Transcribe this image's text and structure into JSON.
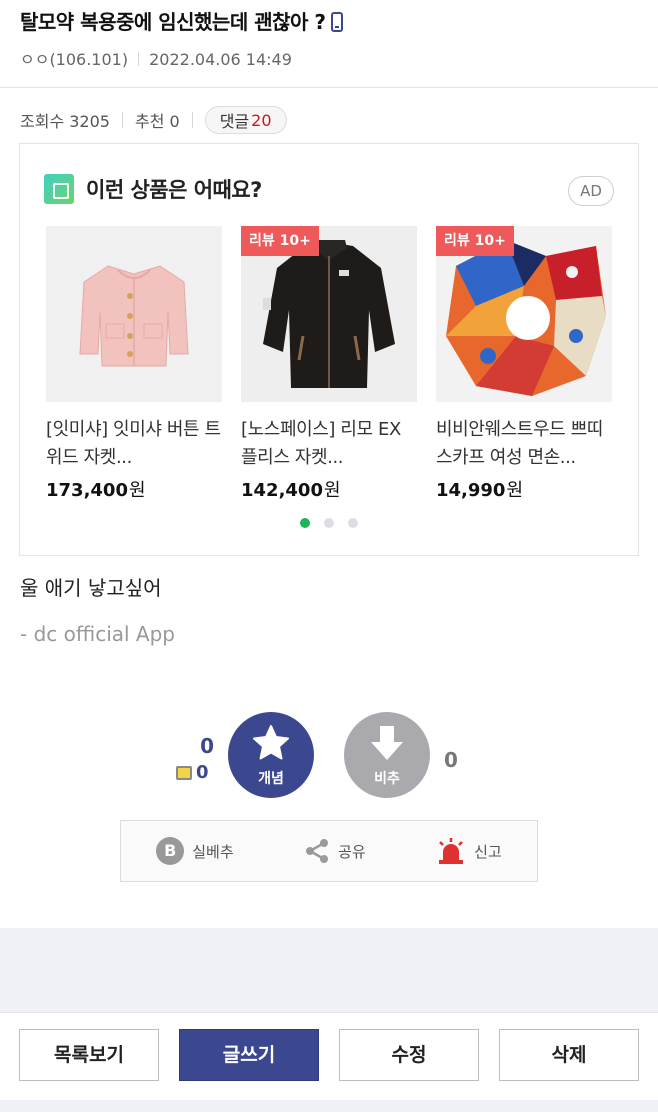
{
  "post": {
    "title": "탈모약 복용중에 임신했는데 괜찮아 ?",
    "author": "ㅇㅇ(106.101)",
    "datetime": "2022.04.06 14:49",
    "views_label": "조회수 3205",
    "recommend_label": "추천 0",
    "comments_label": "댓글",
    "comments_count": "20",
    "body": "울 애기 낳고싶어",
    "source": "- dc official App"
  },
  "ad": {
    "title": "이런 상품은 어때요?",
    "badge": "AD",
    "products": [
      {
        "name": "[잇미샤] 잇미샤 버튼 트위드 자켓...",
        "price": "173,400",
        "currency": "원",
        "tag": ""
      },
      {
        "name": "[노스페이스] 리모 EX 플리스 자켓...",
        "price": "142,400",
        "currency": "원",
        "tag": "리뷰 10+"
      },
      {
        "name": "비비안웨스트우드 쁘띠스카프 여성 면손...",
        "price": "14,990",
        "currency": "원",
        "tag": "리뷰 10+"
      }
    ],
    "carousel_pages": 3,
    "carousel_active": 1
  },
  "votes": {
    "up_count": "0",
    "fixed_count": "0",
    "up_label": "개념",
    "down_label": "비추",
    "down_count": "0"
  },
  "actions": {
    "best_label": "실베추",
    "share_label": "공유",
    "report_label": "신고"
  },
  "bottom": {
    "list_label": "목록보기",
    "write_label": "글쓰기",
    "edit_label": "수정",
    "delete_label": "삭제"
  },
  "colors": {
    "brand": "#3b4890",
    "review_tag": "#ee5a5a",
    "comment_count": "#c5181e",
    "carousel_active": "#1fb35b",
    "report_icon": "#e03131"
  }
}
